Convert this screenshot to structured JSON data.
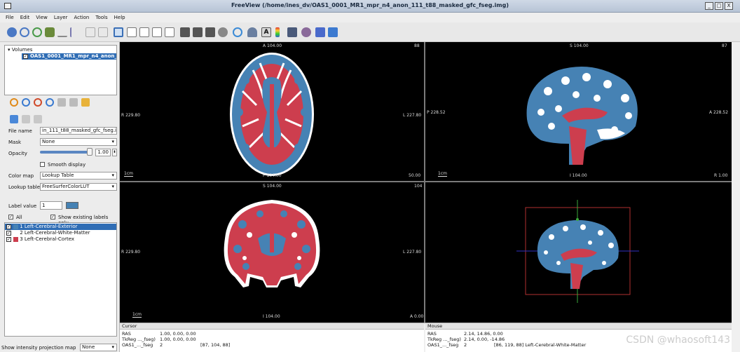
{
  "window": {
    "title": "FreeView (/home/ines_dv/OAS1_0001_MR1_mpr_n4_anon_111_t88_masked_gfc_fseg.img)",
    "buttons": [
      "_",
      "□",
      "X"
    ]
  },
  "menu": [
    "File",
    "Edit",
    "View",
    "Layer",
    "Action",
    "Tools",
    "Help"
  ],
  "layers": {
    "header": "Volumes",
    "selected": "OAS1_0001_MR1_mpr_n4_anon_..."
  },
  "properties": {
    "file_name_label": "File name",
    "file_name_value": "in_111_t88_masked_gfc_fseg.img",
    "mask_label": "Mask",
    "mask_value": "None",
    "opacity_label": "Opacity",
    "opacity_value": "1.00",
    "smooth_label": "Smooth display",
    "color_map_label": "Color map",
    "color_map_value": "Lookup Table",
    "lookup_table_label": "Lookup table",
    "lookup_table_value": "FreeSurferColorLUT",
    "label_value_label": "Label value",
    "label_value": "1",
    "all_label": "All",
    "show_existing_label": "Show existing labels only"
  },
  "labels": [
    {
      "text": "1 Left-Cerebral-Exterior",
      "color": "#4682b4",
      "selected": true
    },
    {
      "text": "2 Left-Cerebral-White-Matter",
      "color": "#ffffff",
      "selected": false
    },
    {
      "text": "3 Left-Cerebral-Cortex",
      "color": "#cd3e4e",
      "selected": false
    }
  ],
  "projection": {
    "label": "Show intensity projection map",
    "value": "None"
  },
  "views": {
    "axial": {
      "top": "A 104.00",
      "bottom": "P 104.00",
      "left": "R 229.80",
      "right": "L 227.80",
      "slice": "88",
      "coord": "50.00",
      "scale": "1cm"
    },
    "sagittal": {
      "top": "S 104.00",
      "bottom": "I 104.00",
      "left": "P 228.52",
      "right": "A 228.52",
      "slice": "87",
      "coord": "R 1.00",
      "scale": "1cm"
    },
    "coronal": {
      "top": "S 104.00",
      "bottom": "I 104.00",
      "left": "R 229.80",
      "right": "L 227.80",
      "slice": "104",
      "coord": "A 0.00",
      "scale": "1cm"
    }
  },
  "cursor_panel": {
    "title": "Cursor",
    "rows": [
      {
        "k": "RAS",
        "v": "1.00, 0.00, 0.00",
        "x": ""
      },
      {
        "k": "TkReg ..._fseg)",
        "v": "1.00, 0.00, 0.00",
        "x": ""
      },
      {
        "k": "OAS1_..._fseg",
        "v": "2",
        "x": "[87, 104, 88]"
      }
    ]
  },
  "mouse_panel": {
    "title": "Mouse",
    "rows": [
      {
        "k": "RAS",
        "v": "2.14, 14.86, 0.00",
        "x": ""
      },
      {
        "k": "TkReg ..._fseg)",
        "v": "2.14, 0.00, -14.86",
        "x": ""
      },
      {
        "k": "OAS1_..._fseg",
        "v": "2",
        "x": "[86, 119, 88]  Left-Cerebral-White-Matter"
      }
    ]
  },
  "watermark": "CSDN @whaosoft143",
  "colors": {
    "exterior": "#4682b4",
    "white_matter": "#ffffff",
    "cortex": "#cd3e4e"
  }
}
